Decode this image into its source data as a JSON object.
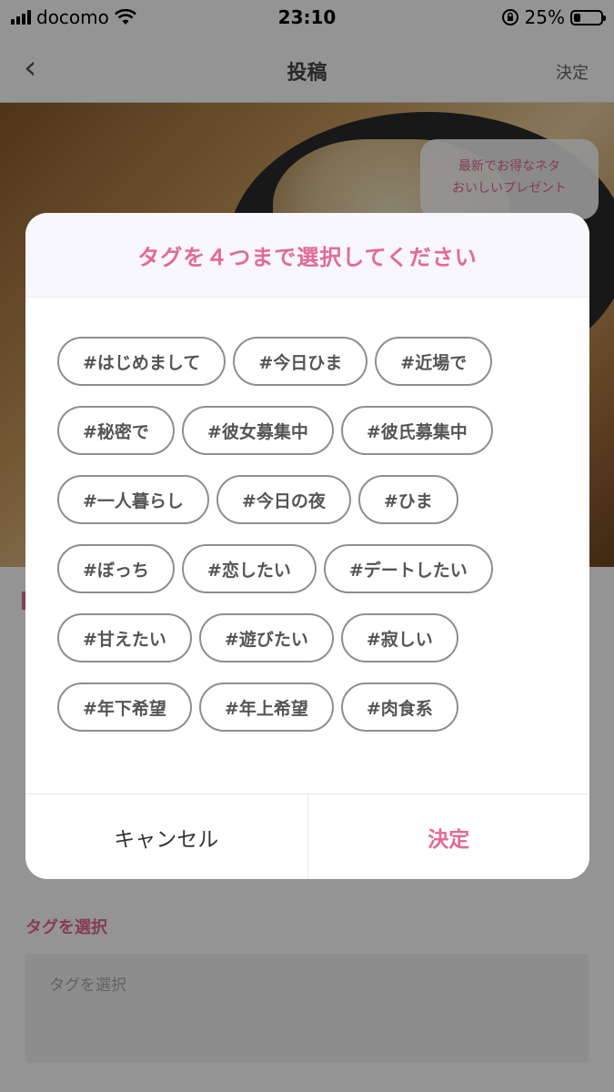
{
  "status_bar": {
    "carrier": "docomo",
    "time": "23:10",
    "battery_percent": "25%",
    "battery_level": 0.25,
    "icons": [
      "signal-icon",
      "wifi-icon",
      "orientation-lock-icon",
      "battery-icon"
    ]
  },
  "nav": {
    "back_icon": "chevron-left-icon",
    "title": "投稿",
    "action_label": "決定"
  },
  "background": {
    "bubble_text_line1": "最新でお得なネタ",
    "bubble_text_line2": "おいしいプレゼント",
    "tag_section_label": "タグを選択",
    "tag_input_placeholder": "タグを選択"
  },
  "modal": {
    "title": "タグを４つまで選択してください",
    "tags": [
      "#はじめまして",
      "#今日ひま",
      "#近場で",
      "#秘密で",
      "#彼女募集中",
      "#彼氏募集中",
      "#一人暮らし",
      "#今日の夜",
      "#ひま",
      "#ぼっち",
      "#恋したい",
      "#デートしたい",
      "#甘えたい",
      "#遊びたい",
      "#寂しい",
      "#年下希望",
      "#年上希望",
      "#肉食系"
    ],
    "cancel_label": "キャンセル",
    "confirm_label": "決定"
  },
  "colors": {
    "accent": "#e36a94",
    "tag_border": "#8e8e8e",
    "overlay": "rgba(0,0,0,0.42)"
  }
}
